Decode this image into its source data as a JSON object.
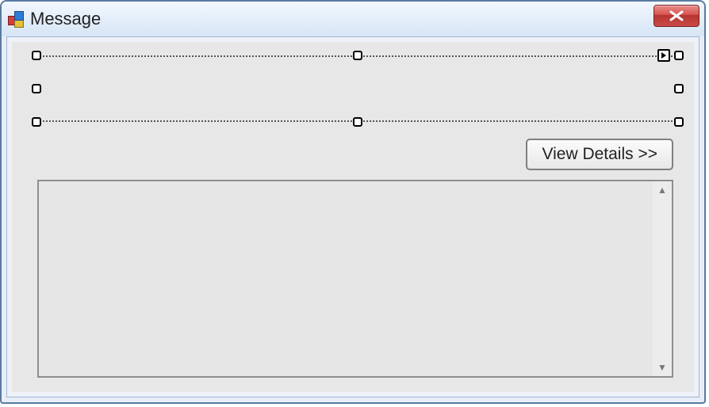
{
  "window": {
    "title": "Message"
  },
  "buttons": {
    "view_details": "View Details >>"
  }
}
